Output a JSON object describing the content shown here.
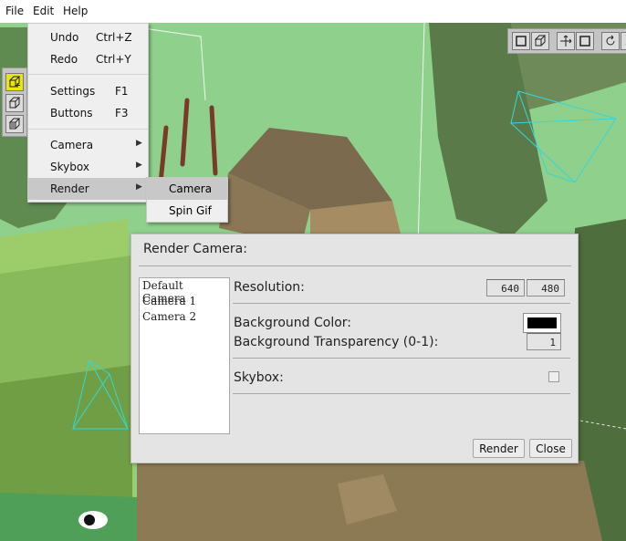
{
  "menubar": {
    "items": [
      "File",
      "Edit",
      "Help"
    ]
  },
  "edit_menu": {
    "items": [
      {
        "label": "Undo",
        "shortcut": "Ctrl+Z"
      },
      {
        "label": "Redo",
        "shortcut": "Ctrl+Y"
      },
      {
        "label": "Settings",
        "shortcut": "F1"
      },
      {
        "label": "Buttons",
        "shortcut": "F3"
      },
      {
        "label": "Camera",
        "submenu": true
      },
      {
        "label": "Skybox",
        "submenu": true
      },
      {
        "label": "Render",
        "submenu": true,
        "highlighted": true
      }
    ]
  },
  "render_submenu": {
    "items": [
      "Camera",
      "Spin Gif"
    ],
    "highlighted": "Camera"
  },
  "dialog": {
    "title": "Render Camera:",
    "cameras": [
      "Default Camera",
      "Camera 1",
      "Camera 2"
    ],
    "resolution_label": "Resolution:",
    "resolution_width": "640",
    "resolution_height": "480",
    "bg_color_label": "Background Color:",
    "bg_color_value": "#000000",
    "bg_transparency_label": "Background Transparency (0-1):",
    "bg_transparency_value": "1",
    "skybox_label": "Skybox:",
    "skybox_checked": false,
    "render_button": "Render",
    "close_button": "Close"
  },
  "toolbars": {
    "left_icons": [
      "add-cube-icon",
      "cube-icon",
      "cube-outline-icon"
    ],
    "right_icons": [
      "box-select-icon",
      "cube-icon",
      "move-axis-icon",
      "box-icon",
      "rotate-icon",
      "more-icon"
    ],
    "active_color": "#e8e41a"
  }
}
